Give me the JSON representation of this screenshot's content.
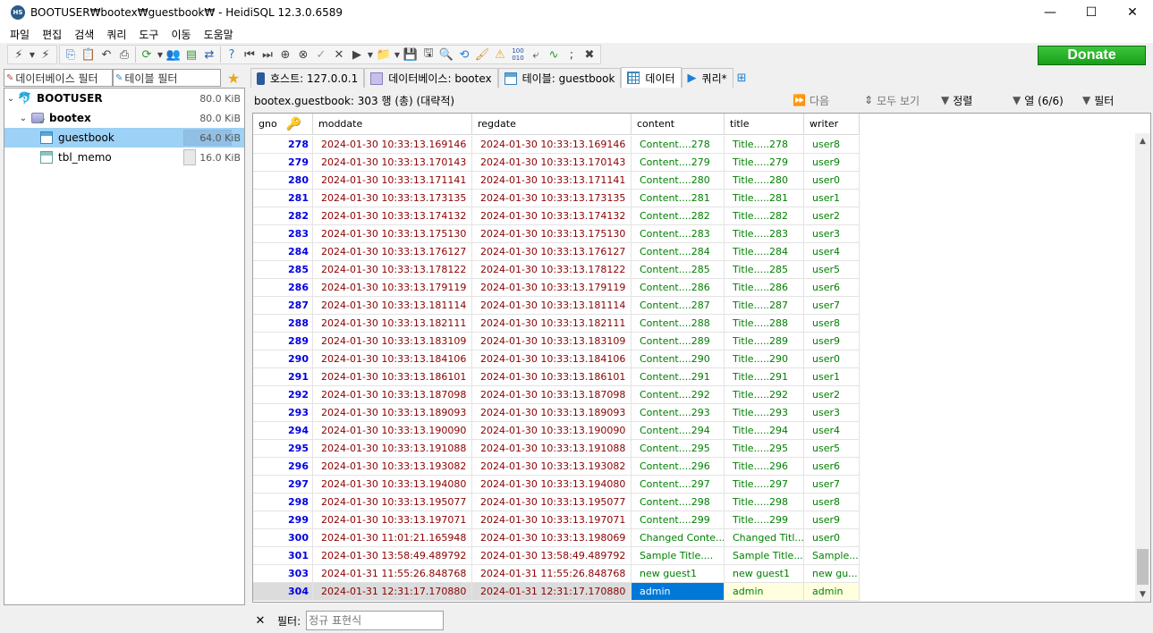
{
  "window": {
    "title": "BOOTUSER₩bootex₩guestbook₩ - HeidiSQL 12.3.0.6589",
    "app_icon": "HS",
    "minimize": "—",
    "maximize": "☐",
    "close": "✕"
  },
  "menu": [
    "파일",
    "편집",
    "검색",
    "쿼리",
    "도구",
    "이동",
    "도움말"
  ],
  "toolbar": {
    "donate_label": "Donate"
  },
  "sidebar": {
    "db_filter_placeholder": "데이터베이스 필터",
    "table_filter_placeholder": "테이블 필터",
    "tree": [
      {
        "label": "BOOTUSER",
        "size": "80.0 KiB",
        "level": 0
      },
      {
        "label": "bootex",
        "size": "80.0 KiB",
        "level": 1
      },
      {
        "label": "guestbook",
        "size": "64.0 KiB",
        "level": 2,
        "selected": true,
        "fill": 0.8
      },
      {
        "label": "tbl_memo",
        "size": "16.0 KiB",
        "level": 2,
        "fill": 0.2
      }
    ]
  },
  "tabs": [
    {
      "label": "호스트: 127.0.0.1",
      "icon": "host-icon"
    },
    {
      "label": "데이터베이스: bootex",
      "icon": "database-icon"
    },
    {
      "label": "테이블: guestbook",
      "icon": "table-icon"
    },
    {
      "label": "데이터",
      "icon": "grid-icon",
      "active": true
    },
    {
      "label": "쿼리*",
      "icon": "play-icon"
    }
  ],
  "data_header": {
    "caption": "bootex.guestbook: 303 행 (총) (대략적)",
    "next": "다음",
    "show_all": "모두 보기",
    "sort": "정렬",
    "columns": "열 (6/6)",
    "filter": "필터"
  },
  "grid": {
    "columns": [
      "gno",
      "moddate",
      "regdate",
      "content",
      "title",
      "writer"
    ],
    "rows": [
      [
        "278",
        "2024-01-30 10:33:13.169146",
        "2024-01-30 10:33:13.169146",
        "Content....278",
        "Title.....278",
        "user8"
      ],
      [
        "279",
        "2024-01-30 10:33:13.170143",
        "2024-01-30 10:33:13.170143",
        "Content....279",
        "Title.....279",
        "user9"
      ],
      [
        "280",
        "2024-01-30 10:33:13.171141",
        "2024-01-30 10:33:13.171141",
        "Content....280",
        "Title.....280",
        "user0"
      ],
      [
        "281",
        "2024-01-30 10:33:13.173135",
        "2024-01-30 10:33:13.173135",
        "Content....281",
        "Title.....281",
        "user1"
      ],
      [
        "282",
        "2024-01-30 10:33:13.174132",
        "2024-01-30 10:33:13.174132",
        "Content....282",
        "Title.....282",
        "user2"
      ],
      [
        "283",
        "2024-01-30 10:33:13.175130",
        "2024-01-30 10:33:13.175130",
        "Content....283",
        "Title.....283",
        "user3"
      ],
      [
        "284",
        "2024-01-30 10:33:13.176127",
        "2024-01-30 10:33:13.176127",
        "Content....284",
        "Title.....284",
        "user4"
      ],
      [
        "285",
        "2024-01-30 10:33:13.178122",
        "2024-01-30 10:33:13.178122",
        "Content....285",
        "Title.....285",
        "user5"
      ],
      [
        "286",
        "2024-01-30 10:33:13.179119",
        "2024-01-30 10:33:13.179119",
        "Content....286",
        "Title.....286",
        "user6"
      ],
      [
        "287",
        "2024-01-30 10:33:13.181114",
        "2024-01-30 10:33:13.181114",
        "Content....287",
        "Title.....287",
        "user7"
      ],
      [
        "288",
        "2024-01-30 10:33:13.182111",
        "2024-01-30 10:33:13.182111",
        "Content....288",
        "Title.....288",
        "user8"
      ],
      [
        "289",
        "2024-01-30 10:33:13.183109",
        "2024-01-30 10:33:13.183109",
        "Content....289",
        "Title.....289",
        "user9"
      ],
      [
        "290",
        "2024-01-30 10:33:13.184106",
        "2024-01-30 10:33:13.184106",
        "Content....290",
        "Title.....290",
        "user0"
      ],
      [
        "291",
        "2024-01-30 10:33:13.186101",
        "2024-01-30 10:33:13.186101",
        "Content....291",
        "Title.....291",
        "user1"
      ],
      [
        "292",
        "2024-01-30 10:33:13.187098",
        "2024-01-30 10:33:13.187098",
        "Content....292",
        "Title.....292",
        "user2"
      ],
      [
        "293",
        "2024-01-30 10:33:13.189093",
        "2024-01-30 10:33:13.189093",
        "Content....293",
        "Title.....293",
        "user3"
      ],
      [
        "294",
        "2024-01-30 10:33:13.190090",
        "2024-01-30 10:33:13.190090",
        "Content....294",
        "Title.....294",
        "user4"
      ],
      [
        "295",
        "2024-01-30 10:33:13.191088",
        "2024-01-30 10:33:13.191088",
        "Content....295",
        "Title.....295",
        "user5"
      ],
      [
        "296",
        "2024-01-30 10:33:13.193082",
        "2024-01-30 10:33:13.193082",
        "Content....296",
        "Title.....296",
        "user6"
      ],
      [
        "297",
        "2024-01-30 10:33:13.194080",
        "2024-01-30 10:33:13.194080",
        "Content....297",
        "Title.....297",
        "user7"
      ],
      [
        "298",
        "2024-01-30 10:33:13.195077",
        "2024-01-30 10:33:13.195077",
        "Content....298",
        "Title.....298",
        "user8"
      ],
      [
        "299",
        "2024-01-30 10:33:13.197071",
        "2024-01-30 10:33:13.197071",
        "Content....299",
        "Title.....299",
        "user9"
      ],
      [
        "300",
        "2024-01-30 11:01:21.165948",
        "2024-01-30 10:33:13.198069",
        "Changed Conte...",
        "Changed Titl...",
        "user0"
      ],
      [
        "301",
        "2024-01-30 13:58:49.489792",
        "2024-01-30 13:58:49.489792",
        "Sample Title....",
        "Sample Title....",
        "Sample..."
      ],
      [
        "303",
        "2024-01-31 11:55:26.848768",
        "2024-01-31 11:55:26.848768",
        "new guest1",
        "new guest1",
        "new gu..."
      ],
      [
        "304",
        "2024-01-31 12:31:17.170880",
        "2024-01-31 12:31:17.170880",
        "admin",
        "admin",
        "admin"
      ]
    ],
    "selected_row": 25
  },
  "bottom": {
    "filter_label": "필터:",
    "regex_placeholder": "정규 표현식"
  }
}
